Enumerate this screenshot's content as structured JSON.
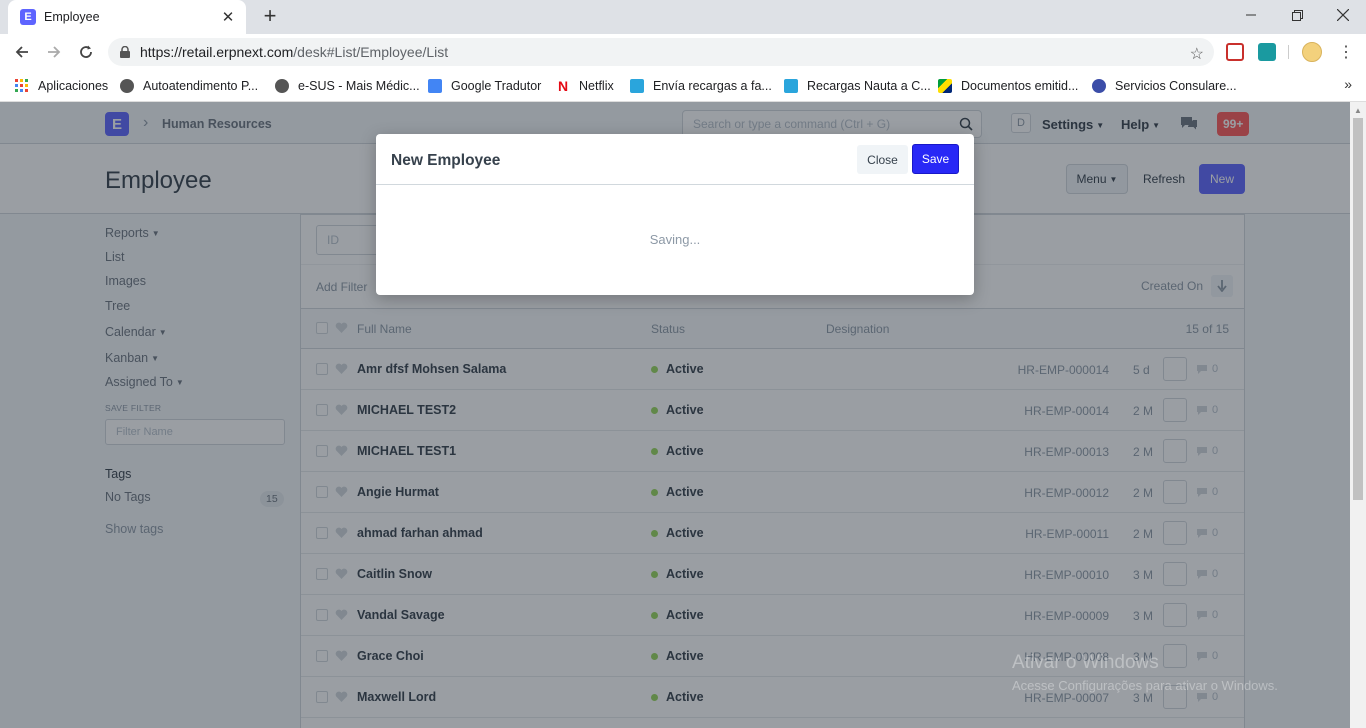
{
  "browser": {
    "tab_title": "Employee",
    "tab_favicon_letter": "E",
    "url_host": "https://retail.erpnext.com",
    "url_path": "/desk#List/Employee/List",
    "bookmarks": [
      {
        "label": "Aplicaciones",
        "icon": "apps-grid-icon"
      },
      {
        "label": "Autoatendimento P...",
        "icon": "globe-icon"
      },
      {
        "label": "e-SUS - Mais Médic...",
        "icon": "globe-icon"
      },
      {
        "label": "Google Tradutor",
        "icon": "google-translate-icon"
      },
      {
        "label": "Netflix",
        "icon": "netflix-icon"
      },
      {
        "label": "Envía recargas a fa...",
        "icon": "bird-icon"
      },
      {
        "label": "Recargas Nauta a C...",
        "icon": "bird-icon"
      },
      {
        "label": "Documentos emitid...",
        "icon": "flag-icon"
      },
      {
        "label": "Servicios Consulare...",
        "icon": "seal-icon"
      }
    ]
  },
  "navbar": {
    "breadcrumb": "Human Resources",
    "search_placeholder": "Search or type a command (Ctrl + G)",
    "avatar_letter": "D",
    "settings_label": "Settings",
    "help_label": "Help",
    "notification_count": "99+"
  },
  "page": {
    "title": "Employee",
    "menu_label": "Menu",
    "refresh_label": "Refresh",
    "new_label": "New"
  },
  "sidebar": {
    "reports": "Reports",
    "list": "List",
    "images": "Images",
    "tree": "Tree",
    "calendar": "Calendar",
    "kanban": "Kanban",
    "assigned_to": "Assigned To",
    "save_filter": "SAVE FILTER",
    "filter_name_placeholder": "Filter Name",
    "tags": "Tags",
    "no_tags": "No Tags",
    "no_tags_count": "15",
    "show_tags": "Show tags"
  },
  "list": {
    "id_placeholder": "ID",
    "add_filter": "Add Filter",
    "sort_label": "Created On",
    "col_full_name": "Full Name",
    "col_status": "Status",
    "col_designation": "Designation",
    "count": "15 of 15",
    "rows": [
      {
        "name": "Amr dfsf Mohsen Salama",
        "status": "Active",
        "id": "HR-EMP-000014",
        "time": "5 d",
        "comments": "0"
      },
      {
        "name": "MICHAEL TEST2",
        "status": "Active",
        "id": "HR-EMP-00014",
        "time": "2 M",
        "comments": "0"
      },
      {
        "name": "MICHAEL TEST1",
        "status": "Active",
        "id": "HR-EMP-00013",
        "time": "2 M",
        "comments": "0"
      },
      {
        "name": "Angie Hurmat",
        "status": "Active",
        "id": "HR-EMP-00012",
        "time": "2 M",
        "comments": "0"
      },
      {
        "name": "ahmad farhan ahmad",
        "status": "Active",
        "id": "HR-EMP-00011",
        "time": "2 M",
        "comments": "0"
      },
      {
        "name": "Caitlin Snow",
        "status": "Active",
        "id": "HR-EMP-00010",
        "time": "3 M",
        "comments": "0"
      },
      {
        "name": "Vandal Savage",
        "status": "Active",
        "id": "HR-EMP-00009",
        "time": "3 M",
        "comments": "0"
      },
      {
        "name": "Grace Choi",
        "status": "Active",
        "id": "HR-EMP-00008",
        "time": "3 M",
        "comments": "0"
      },
      {
        "name": "Maxwell Lord",
        "status": "Active",
        "id": "HR-EMP-00007",
        "time": "3 M",
        "comments": "0"
      }
    ]
  },
  "modal": {
    "title": "New Employee",
    "close_label": "Close",
    "save_label": "Save",
    "body_text": "Saving..."
  },
  "watermark": {
    "title": "Ativar o Windows",
    "subtitle": "Acesse Configurações para ativar o Windows."
  },
  "colors": {
    "brand": "#5e64ff",
    "save_button": "#2828f6",
    "status_active": "#98d85b",
    "notification": "#ff5858"
  }
}
